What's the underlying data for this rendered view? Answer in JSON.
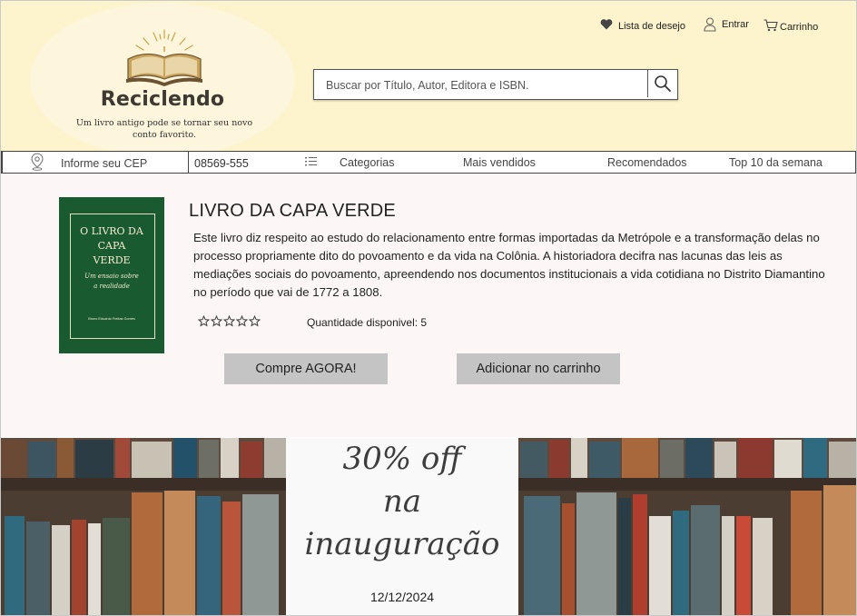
{
  "header": {
    "brand": "Reciclendo",
    "tagline": "Um livro antigo pode se tornar seu novo conto favorito.",
    "links": {
      "wishlist": "Lista de desejo",
      "login": "Entrar",
      "cart": "Carrinho"
    },
    "search": {
      "placeholder": "Buscar por Título, Autor, Editora e ISBN.",
      "icon": "search-icon"
    }
  },
  "nav": {
    "cep_label": "Informe seu CEP",
    "cep_value": "08569-555",
    "categories": "Categorias",
    "best_sellers": "Mais vendidos",
    "recommended": "Recomendados",
    "top10": "Top 10 da semana"
  },
  "product": {
    "cover": {
      "title_lines": [
        "O LIVRO DA",
        "CAPA",
        "VERDE"
      ],
      "subtitle_lines": [
        "Um ensaio sobre",
        "a realidade"
      ],
      "author": "Bruno Eduardo Freitas Gomes"
    },
    "title": "LIVRO DA CAPA VERDE",
    "description": "Este livro diz respeito ao estudo do relacionamento entre formas importadas da Metrópole e a transformação delas no processo propriamente dito do povoamento e da vida na Colônia. A historiadora decifra nas lacunas das leis as mediações sociais do povoamento, apreendendo nos documentos institucionais a vida cotidiana no Distrito Diamantino no período que vai de 1772 a 1808.",
    "rating": 0,
    "rating_max": 5,
    "quantity": "Quantidade disponivel: 5",
    "buy_now": "Compre AGORA!",
    "add_to_cart": "Adicionar no carrinho"
  },
  "banner": {
    "promo_lines": [
      "30% off",
      "na",
      "inauguração"
    ],
    "date": "12/12/2024"
  },
  "colors": {
    "header_bg": "#fdf3cc",
    "main_bg": "#fcf7f6",
    "button_bg": "#c4c4c4",
    "cover_green": "#1a5a30"
  }
}
